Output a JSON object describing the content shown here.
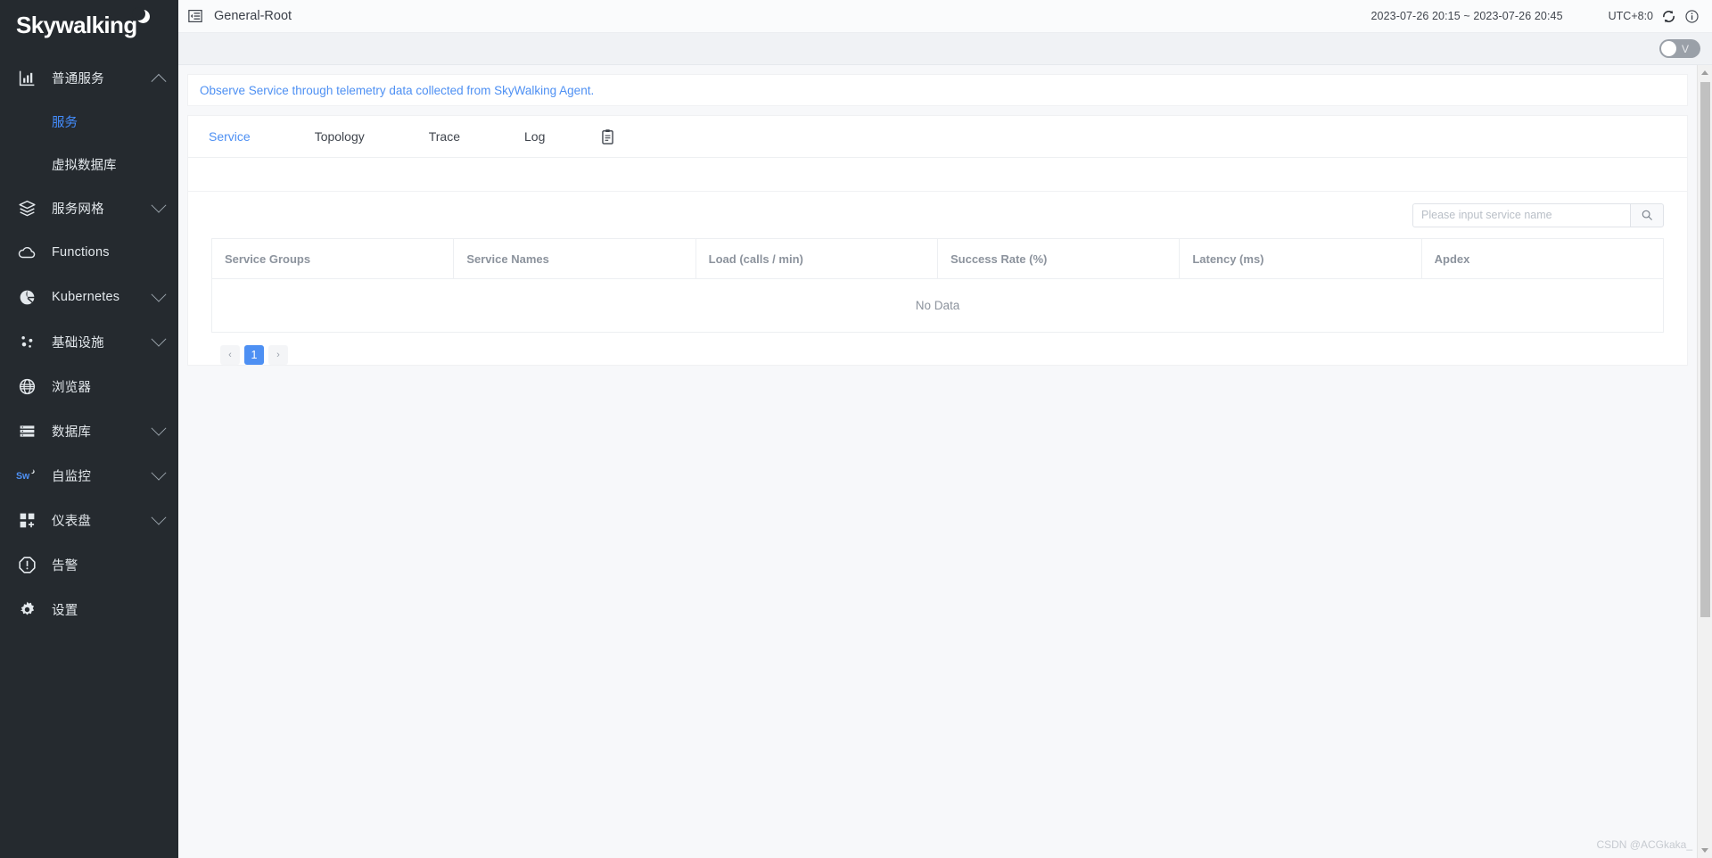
{
  "brand": {
    "name": "Skywalking",
    "logo_icon": "moon-icon"
  },
  "sidebar": {
    "items": [
      {
        "label": "普通服务",
        "icon": "chart-bar-icon",
        "chevron": "chevron-up-icon",
        "expanded": true,
        "children": [
          {
            "label": "服务",
            "active": true
          },
          {
            "label": "虚拟数据库",
            "active": false
          }
        ]
      },
      {
        "label": "服务网格",
        "icon": "layers-icon",
        "chevron": "chevron-down-icon",
        "expanded": false,
        "children": []
      },
      {
        "label": "Functions",
        "icon": "cloud-icon",
        "chevron": "",
        "expanded": false,
        "children": []
      },
      {
        "label": "Kubernetes",
        "icon": "kubernetes-icon",
        "chevron": "chevron-down-icon",
        "expanded": false,
        "children": []
      },
      {
        "label": "基础设施",
        "icon": "nodes-icon",
        "chevron": "chevron-down-icon",
        "expanded": false,
        "children": []
      },
      {
        "label": "浏览器",
        "icon": "globe-icon",
        "chevron": "",
        "expanded": false,
        "children": []
      },
      {
        "label": "数据库",
        "icon": "database-list-icon",
        "chevron": "chevron-down-icon",
        "expanded": false,
        "children": []
      },
      {
        "label": "自监控",
        "icon": "skywalking-sw-icon",
        "chevron": "chevron-down-icon",
        "expanded": false,
        "children": []
      },
      {
        "label": "仪表盘",
        "icon": "dashboard-add-icon",
        "chevron": "chevron-down-icon",
        "expanded": false,
        "children": []
      },
      {
        "label": "告警",
        "icon": "alert-octagon-icon",
        "chevron": "",
        "expanded": false,
        "children": []
      },
      {
        "label": "设置",
        "icon": "gear-icon",
        "chevron": "",
        "expanded": false,
        "children": []
      }
    ]
  },
  "header": {
    "collapse_icon": "collapse-sidebar-icon",
    "title": "General-Root",
    "time_range": "2023-07-26 20:15 ~ 2023-07-26 20:45",
    "timezone": "UTC+8:0",
    "refresh_icon": "refresh-icon",
    "info_icon": "info-circle-icon"
  },
  "subbar": {
    "toggle_label": "V",
    "toggle_on": false
  },
  "banner": {
    "text": "Observe Service through telemetry data collected from SkyWalking Agent."
  },
  "tabs": [
    {
      "label": "Service",
      "active": true
    },
    {
      "label": "Topology",
      "active": false
    },
    {
      "label": "Trace",
      "active": false
    },
    {
      "label": "Log",
      "active": false
    }
  ],
  "tab_icon": "clipboard-icon",
  "search": {
    "value": "",
    "placeholder": "Please input service name",
    "button_icon": "search-icon"
  },
  "table": {
    "columns": [
      "Service Groups",
      "Service Names",
      "Load (calls / min)",
      "Success Rate (%)",
      "Latency (ms)",
      "Apdex"
    ],
    "rows": [],
    "empty_text": "No Data"
  },
  "pagination": {
    "prev_icon": "chevron-left-icon",
    "next_icon": "chevron-right-icon",
    "pages": [
      "1"
    ],
    "current": "1"
  },
  "watermark": "CSDN @ACGkaka_",
  "colors": {
    "sidebar_bg": "#252a2f",
    "accent": "#4e90f3",
    "page_bg": "#f7f8fa",
    "muted_text": "#8c939d"
  }
}
